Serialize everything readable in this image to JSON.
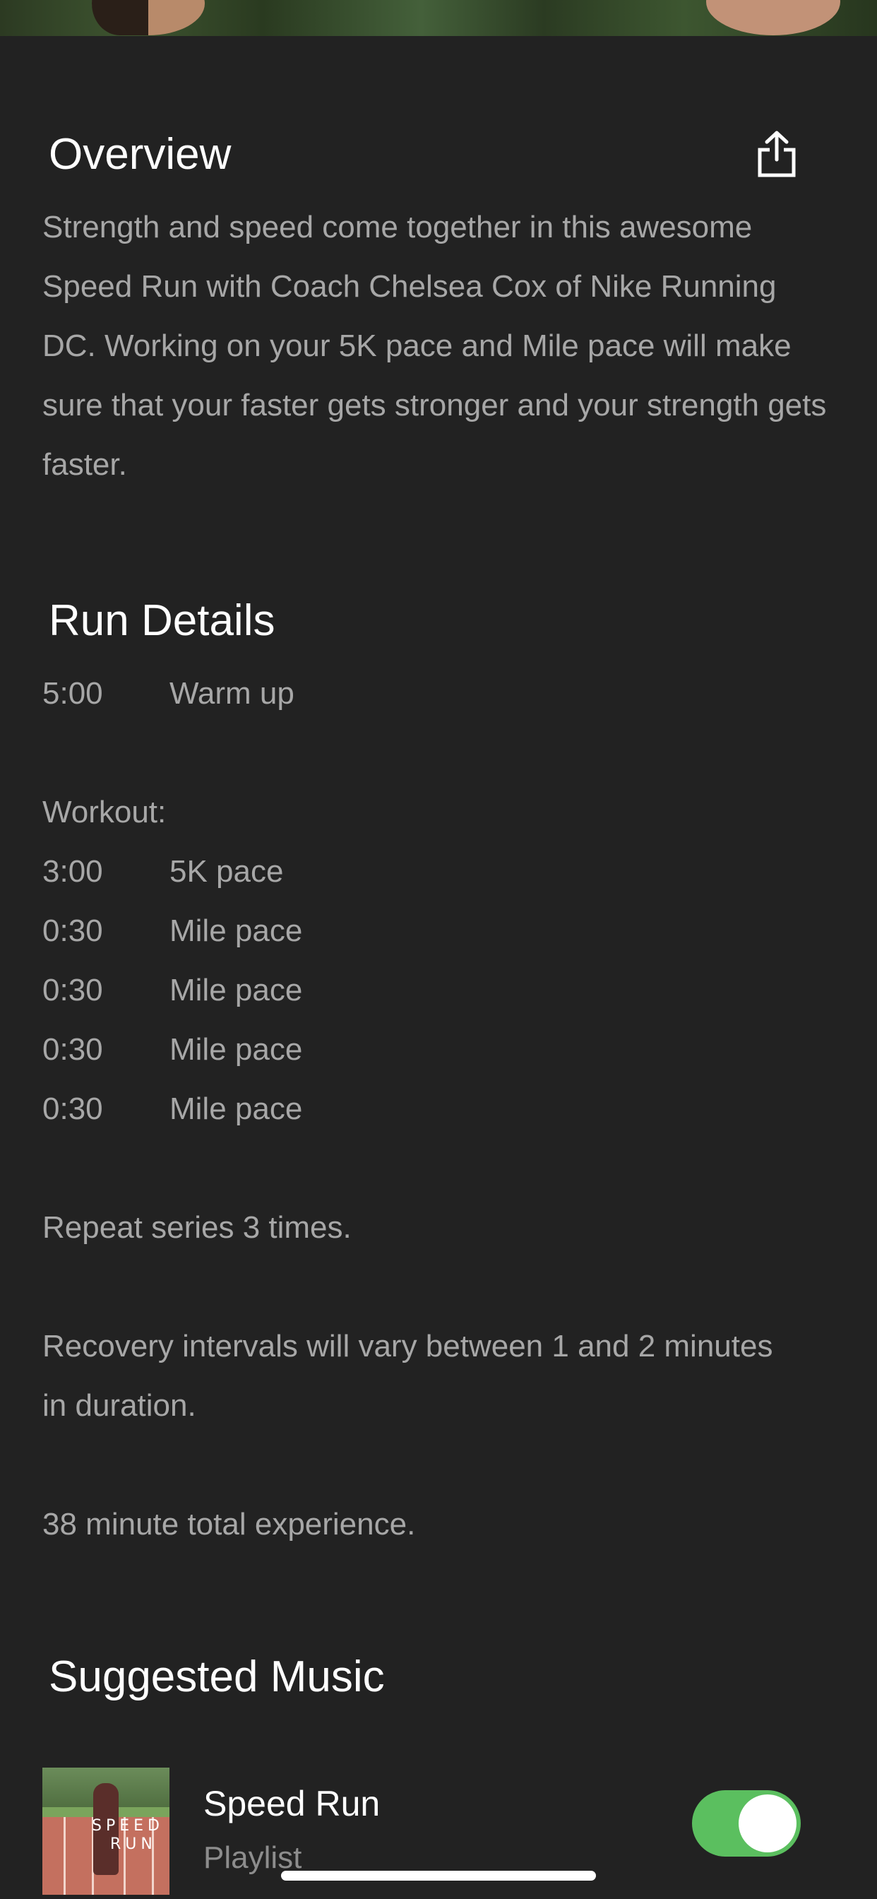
{
  "overview": {
    "title": "Overview",
    "share_icon": "share-icon",
    "description": "Strength and speed come together in this awesome Speed Run with Coach Chelsea Cox of Nike Running DC. Working on your 5K pace and Mile pace will make sure that your faster gets stronger and your strength gets faster."
  },
  "run_details": {
    "title": "Run Details",
    "warmup": {
      "time": "5:00",
      "label": "Warm up"
    },
    "workout_label": "Workout:",
    "intervals": [
      {
        "time": "3:00",
        "label": "5K pace"
      },
      {
        "time": "0:30",
        "label": "Mile pace"
      },
      {
        "time": "0:30",
        "label": "Mile pace"
      },
      {
        "time": "0:30",
        "label": "Mile pace"
      },
      {
        "time": "0:30",
        "label": "Mile pace"
      }
    ],
    "repeat": "Repeat series 3 times.",
    "recovery": "Recovery intervals will vary between 1 and 2 minutes in duration.",
    "total": "38 minute total experience."
  },
  "music": {
    "title": "Suggested Music",
    "item": {
      "name": "Speed Run",
      "type": "Playlist",
      "art_text_1": "SPEED",
      "art_text_2": "RUN",
      "enabled": true
    }
  },
  "colors": {
    "background": "#222222",
    "text_primary": "#ffffff",
    "text_secondary": "#a7a7a7",
    "toggle_on": "#5bbf5f"
  }
}
